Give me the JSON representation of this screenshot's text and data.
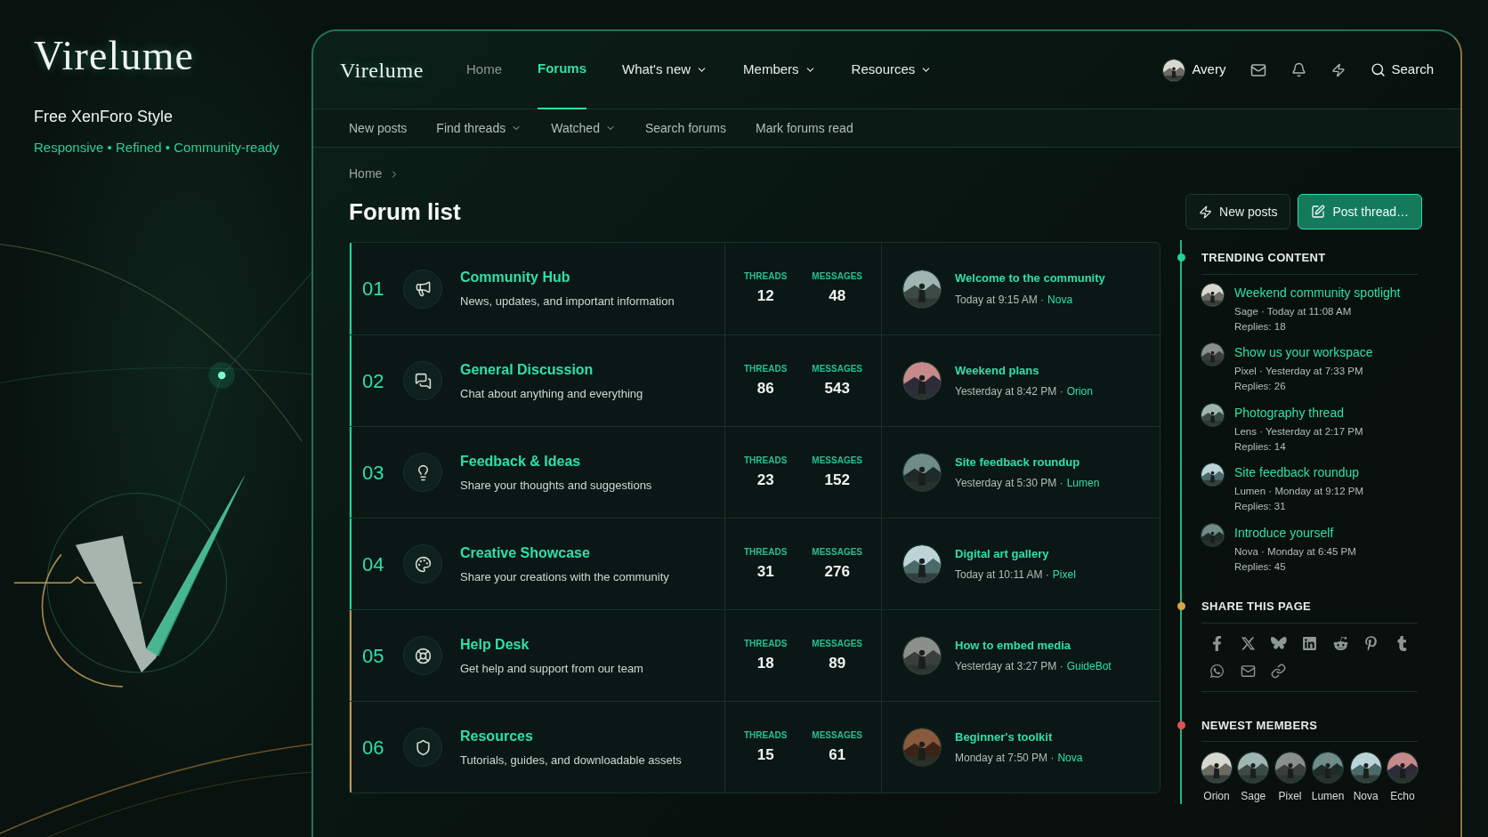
{
  "brand": {
    "logo": "Virelume",
    "subtitle": "Free XenForo Style",
    "tagline": "Responsive • Refined • Community-ready"
  },
  "header": {
    "logo": "Virelume",
    "nav": [
      {
        "label": "Home",
        "selected": false,
        "has_menu": false
      },
      {
        "label": "Forums",
        "selected": true,
        "has_menu": false
      },
      {
        "label": "What's new",
        "selected": false,
        "has_menu": true
      },
      {
        "label": "Members",
        "selected": false,
        "has_menu": true
      },
      {
        "label": "Resources",
        "selected": false,
        "has_menu": true
      }
    ],
    "user": "Avery",
    "search": "Search"
  },
  "subnav": [
    {
      "label": "New posts",
      "has_menu": false
    },
    {
      "label": "Find threads",
      "has_menu": true
    },
    {
      "label": "Watched",
      "has_menu": true
    },
    {
      "label": "Search forums",
      "has_menu": false
    },
    {
      "label": "Mark forums read",
      "has_menu": false
    }
  ],
  "breadcrumb": [
    "Home"
  ],
  "title": "Forum list",
  "buttons": [
    {
      "label": "New posts",
      "kind": "secondary"
    },
    {
      "label": "Post thread…",
      "kind": "primary"
    }
  ],
  "forums": [
    {
      "number": "01",
      "title": "Community Hub",
      "description": "News, updates, and important information",
      "color": "#1fd39a",
      "threads_label": "THREADS",
      "threads": "12",
      "messages_label": "MESSAGES",
      "messages": "48",
      "latest": {
        "title": "Welcome to the community",
        "time": "Today at 9:15 AM ·",
        "user": "Nova"
      }
    },
    {
      "number": "02",
      "title": "General Discussion",
      "description": "Chat about anything and everything",
      "color": "#1fd39a",
      "threads_label": "THREADS",
      "threads": "86",
      "messages_label": "MESSAGES",
      "messages": "543",
      "latest": {
        "title": "Weekend plans",
        "time": "Yesterday at 8:42 PM ·",
        "user": "Orion"
      }
    },
    {
      "number": "03",
      "title": "Feedback & Ideas",
      "description": "Share your thoughts and suggestions",
      "color": "#1fd39a",
      "threads_label": "THREADS",
      "threads": "23",
      "messages_label": "MESSAGES",
      "messages": "152",
      "latest": {
        "title": "Site feedback roundup",
        "time": "Yesterday at 5:30 PM ·",
        "user": "Lumen"
      }
    },
    {
      "number": "04",
      "title": "Creative Showcase",
      "description": "Share your creations with the community",
      "color": "#1fd39a",
      "threads_label": "THREADS",
      "threads": "31",
      "messages_label": "MESSAGES",
      "messages": "276",
      "latest": {
        "title": "Digital art gallery",
        "time": "Today at 10:11 AM ·",
        "user": "Pixel"
      }
    },
    {
      "number": "05",
      "title": "Help Desk",
      "description": "Get help and support from our team",
      "color": "#b8955a",
      "threads_label": "THREADS",
      "threads": "18",
      "messages_label": "MESSAGES",
      "messages": "89",
      "latest": {
        "title": "How to embed media",
        "time": "Yesterday at 3:27 PM ·",
        "user": "GuideBot"
      }
    },
    {
      "number": "06",
      "title": "Resources",
      "description": "Tutorials, guides, and downloadable assets",
      "color": "#b8955a",
      "threads_label": "THREADS",
      "threads": "15",
      "messages_label": "MESSAGES",
      "messages": "61",
      "latest": {
        "title": "Beginner's toolkit",
        "time": "Monday at 7:50 PM ·",
        "user": "Nova"
      }
    }
  ],
  "sidebar": {
    "trending": {
      "title": "TRENDING CONTENT",
      "color": "#1fd39a",
      "items": [
        {
          "title": "Weekend community spotlight",
          "meta": "Sage · Today at 11:08 AM",
          "replies": "Replies: 18"
        },
        {
          "title": "Show us your workspace",
          "meta": "Pixel · Yesterday at 7:33 PM",
          "replies": "Replies: 26"
        },
        {
          "title": "Photography thread",
          "meta": "Lens · Yesterday at 2:17 PM",
          "replies": "Replies: 14"
        },
        {
          "title": "Site feedback roundup",
          "meta": "Lumen · Monday at 9:12 PM",
          "replies": "Replies: 31"
        },
        {
          "title": "Introduce yourself",
          "meta": "Nova · Monday at 6:45 PM",
          "replies": "Replies: 45"
        }
      ]
    },
    "share": {
      "title": "SHARE THIS PAGE",
      "color": "#d9a441"
    },
    "members": {
      "title": "NEWEST MEMBERS",
      "color": "#e05252",
      "items": [
        {
          "name": "Orion"
        },
        {
          "name": "Sage"
        },
        {
          "name": "Pixel"
        },
        {
          "name": "Lumen"
        },
        {
          "name": "Nova"
        },
        {
          "name": "Echo"
        }
      ]
    }
  }
}
